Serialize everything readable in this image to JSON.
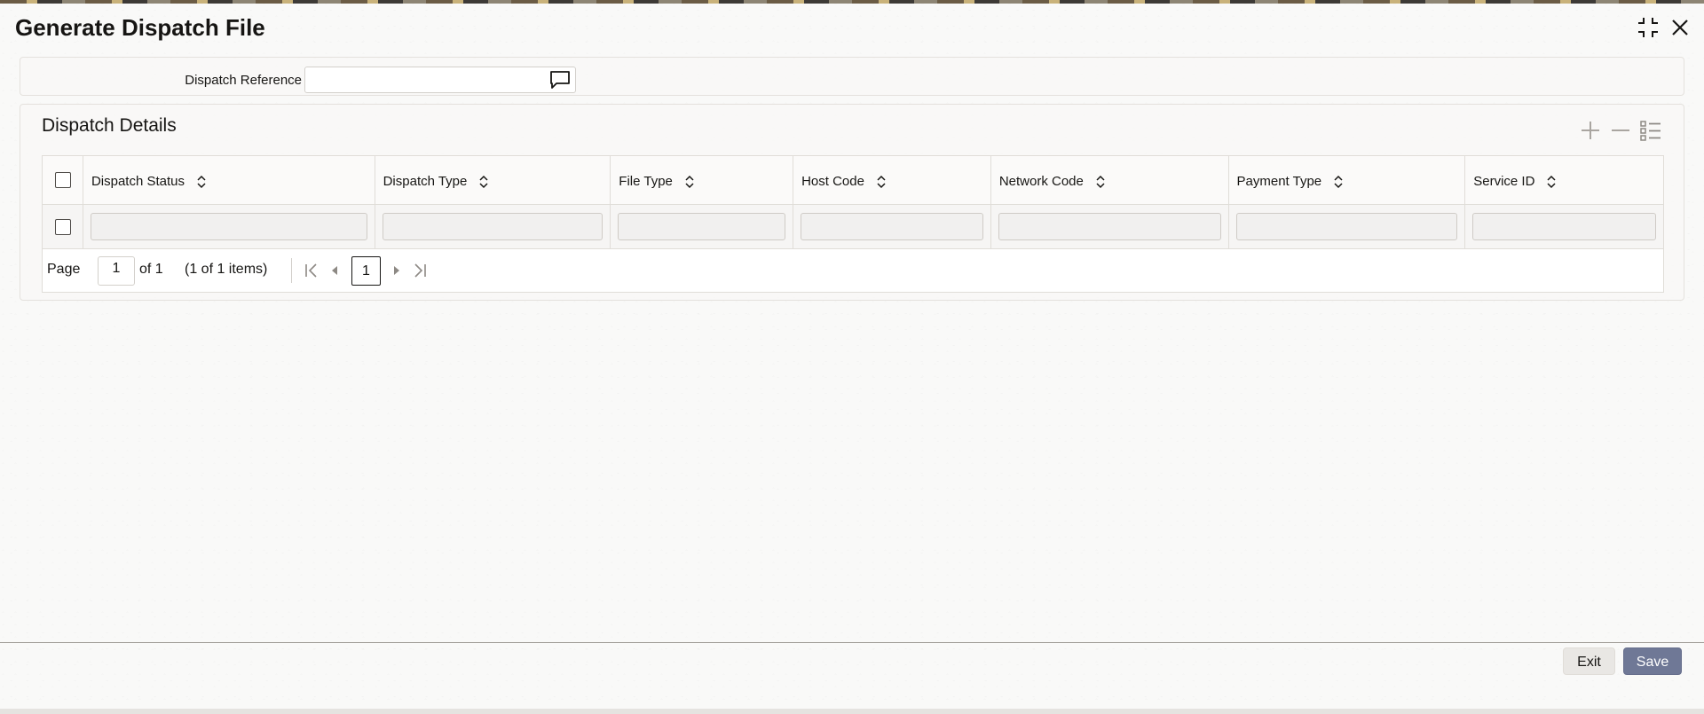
{
  "window": {
    "title": "Generate Dispatch File",
    "controls": {
      "minimize_icon": "compress-icon",
      "close_icon": "close-icon"
    }
  },
  "dispatch_reference": {
    "label": "Dispatch Reference",
    "value": "",
    "lov_icon": "speech-bubble-icon"
  },
  "dispatch_details": {
    "title": "Dispatch Details",
    "tools": [
      "plus-icon",
      "minus-icon",
      "list-icon"
    ],
    "columns": [
      "Dispatch Status",
      "Dispatch Type",
      "File Type",
      "Host Code",
      "Network Code",
      "Payment Type",
      "Service ID"
    ],
    "rows": [
      {
        "dispatch_status": "",
        "dispatch_type": "",
        "file_type": "",
        "host_code": "",
        "network_code": "",
        "payment_type": "",
        "service_id": ""
      }
    ],
    "pager": {
      "page_label": "Page",
      "current_page": "1",
      "of_label": "of 1",
      "items_label": "(1 of 1 items)",
      "page_number": "1"
    }
  },
  "footer": {
    "exit_label": "Exit",
    "save_label": "Save"
  },
  "colors": {
    "accent": "#6f7896",
    "text": "#161513",
    "border": "#e0ddd8"
  }
}
